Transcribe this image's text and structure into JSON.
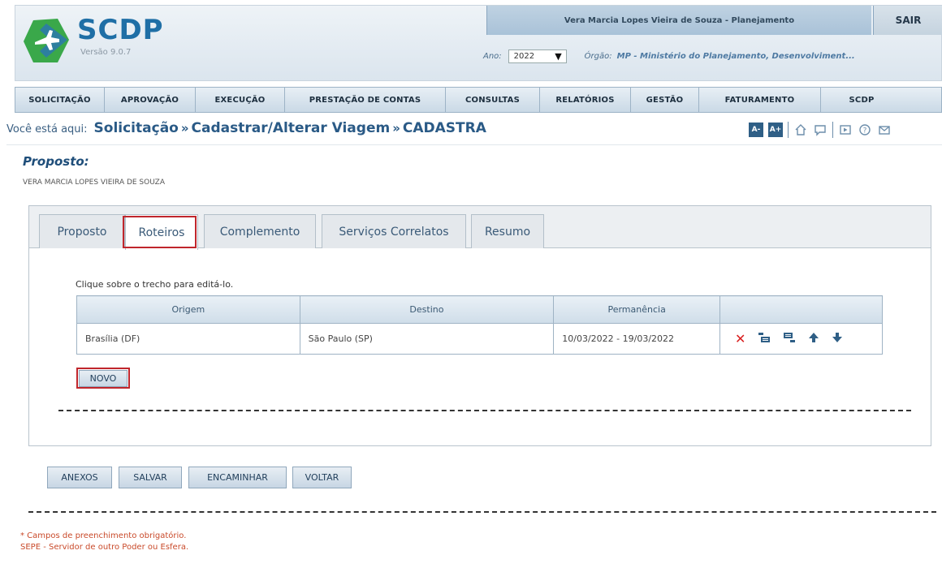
{
  "header": {
    "logo_text": "SCDP",
    "version": "Versão 9.0.7",
    "user": "Vera Marcia Lopes Vieira de Souza - Planejamento",
    "logout": "SAIR",
    "ano_label": "Ano:",
    "ano_value": "2022",
    "orgao_label": "Órgão:",
    "orgao_value": "MP - Ministério do Planejamento, Desenvolviment..."
  },
  "nav": [
    "SOLICITAÇÃO",
    "APROVAÇÃO",
    "EXECUÇÃO",
    "PRESTAÇÃO DE CONTAS",
    "CONSULTAS",
    "RELATÓRIOS",
    "GESTÃO",
    "FATURAMENTO",
    "SCDP"
  ],
  "breadcrumb": {
    "label": "Você está aqui:",
    "items": [
      "Solicitação",
      "Cadastrar/Alterar Viagem",
      "CADASTRA"
    ],
    "sep": "»"
  },
  "tools": {
    "font_minus": "A-",
    "font_plus": "A+"
  },
  "proposto": {
    "title": "Proposto:",
    "name": "VERA MARCIA LOPES VIEIRA DE SOUZA"
  },
  "tabs": [
    "Proposto",
    "Roteiros",
    "Complemento",
    "Serviços Correlatos",
    "Resumo"
  ],
  "active_tab": "Roteiros",
  "roteiros": {
    "hint": "Clique sobre o trecho para editá-lo.",
    "columns": [
      "Origem",
      "Destino",
      "Permanência",
      ""
    ],
    "rows": [
      {
        "origem": "Brasília (DF)",
        "destino": "São Paulo (SP)",
        "permanencia": "10/03/2022 - 19/03/2022"
      }
    ],
    "novo": "NOVO"
  },
  "buttons": {
    "anexos": "ANEXOS",
    "salvar": "SALVAR",
    "encaminhar": "ENCAMINHAR",
    "voltar": "VOLTAR"
  },
  "footnotes": {
    "required": "* Campos de preenchimento obrigatório.",
    "sepe": "SEPE - Servidor de outro Poder ou Esfera."
  },
  "colors": {
    "highlight": "#c0262c",
    "brand": "#1f6fa6",
    "logo_green": "#3aa84a",
    "logo_dark": "#1f5f8a"
  }
}
